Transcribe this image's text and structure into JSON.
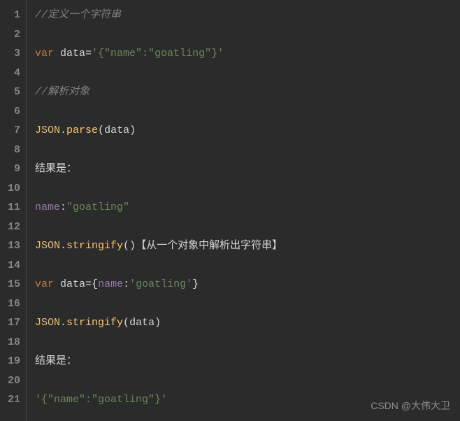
{
  "lines": [
    {
      "segments": [
        {
          "cls": "comment",
          "t": "//定义一个字符串"
        }
      ]
    },
    {
      "segments": []
    },
    {
      "segments": [
        {
          "cls": "keyword",
          "t": "var "
        },
        {
          "cls": "ident",
          "t": "data"
        },
        {
          "cls": "op",
          "t": "="
        },
        {
          "cls": "string",
          "t": "'{\"name\":\"goatling\"}'"
        }
      ]
    },
    {
      "segments": []
    },
    {
      "segments": [
        {
          "cls": "comment",
          "t": "//解析对象"
        }
      ]
    },
    {
      "segments": []
    },
    {
      "segments": [
        {
          "cls": "obj",
          "t": "JSON"
        },
        {
          "cls": "op",
          "t": "."
        },
        {
          "cls": "method",
          "t": "parse"
        },
        {
          "cls": "paren",
          "t": "("
        },
        {
          "cls": "ident",
          "t": "data"
        },
        {
          "cls": "paren",
          "t": ")"
        }
      ]
    },
    {
      "segments": []
    },
    {
      "segments": [
        {
          "cls": "text",
          "t": "结果是："
        }
      ]
    },
    {
      "segments": []
    },
    {
      "segments": [
        {
          "cls": "prop",
          "t": "name"
        },
        {
          "cls": "op",
          "t": ":"
        },
        {
          "cls": "string",
          "t": "\"goatling\""
        }
      ]
    },
    {
      "segments": []
    },
    {
      "segments": [
        {
          "cls": "obj",
          "t": "JSON"
        },
        {
          "cls": "op",
          "t": "."
        },
        {
          "cls": "method",
          "t": "stringify"
        },
        {
          "cls": "paren",
          "t": "()"
        },
        {
          "cls": "text",
          "t": "【从一个对象中解析出字符串】"
        }
      ]
    },
    {
      "segments": []
    },
    {
      "segments": [
        {
          "cls": "keyword",
          "t": "var "
        },
        {
          "cls": "ident",
          "t": "data"
        },
        {
          "cls": "op",
          "t": "="
        },
        {
          "cls": "paren",
          "t": "{"
        },
        {
          "cls": "prop",
          "t": "name"
        },
        {
          "cls": "op",
          "t": ":"
        },
        {
          "cls": "string",
          "t": "'goatling'"
        },
        {
          "cls": "paren",
          "t": "}"
        }
      ]
    },
    {
      "segments": []
    },
    {
      "segments": [
        {
          "cls": "obj",
          "t": "JSON"
        },
        {
          "cls": "op",
          "t": "."
        },
        {
          "cls": "method",
          "t": "stringify"
        },
        {
          "cls": "paren",
          "t": "("
        },
        {
          "cls": "ident",
          "t": "data"
        },
        {
          "cls": "paren",
          "t": ")"
        }
      ]
    },
    {
      "segments": []
    },
    {
      "segments": [
        {
          "cls": "text",
          "t": "结果是："
        }
      ]
    },
    {
      "segments": []
    },
    {
      "segments": [
        {
          "cls": "string",
          "t": "'{\"name\":\"goatling\"}'"
        }
      ]
    }
  ],
  "watermark": "CSDN @大伟大卫"
}
